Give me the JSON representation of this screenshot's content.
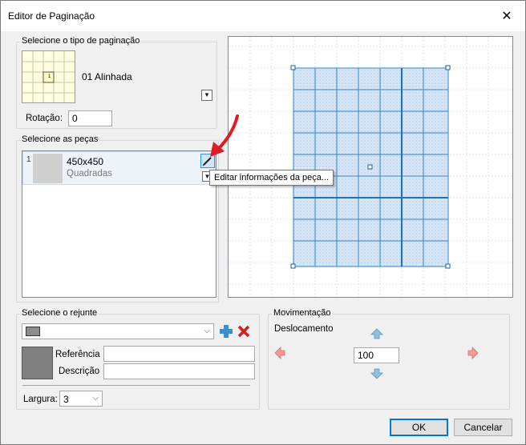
{
  "window": {
    "title": "Editor de Paginação",
    "close_glyph": "✕"
  },
  "pagination_type": {
    "legend": "Selecione o tipo de paginação",
    "thumb_label": "1",
    "selected_name": "01 Alinhada",
    "rotation_label": "Rotação:",
    "rotation_value": "0"
  },
  "pieces": {
    "legend": "Selecione as peças",
    "items": [
      {
        "index": "1",
        "name": "450x450",
        "type": "Quadradas"
      }
    ],
    "tooltip": "Editar informações da peça..."
  },
  "grout": {
    "legend": "Selecione o rejunte",
    "swatch_color": "#8c8c8c",
    "reference_label": "Referência",
    "reference_value": "",
    "description_label": "Descrição",
    "description_value": "",
    "width_label": "Largura:",
    "width_value": "3"
  },
  "movement": {
    "legend": "Movimentação",
    "offset_label": "Deslocamento",
    "offset_value": "100"
  },
  "buttons": {
    "ok": "OK",
    "cancel": "Cancelar"
  },
  "colors": {
    "tile_fill": "#cfe0f5",
    "tile_line": "#2f86c9",
    "grid_line": "#cde3f4",
    "arrow_red": "#e11b22",
    "arrow_blue": "#3a8fd1"
  }
}
